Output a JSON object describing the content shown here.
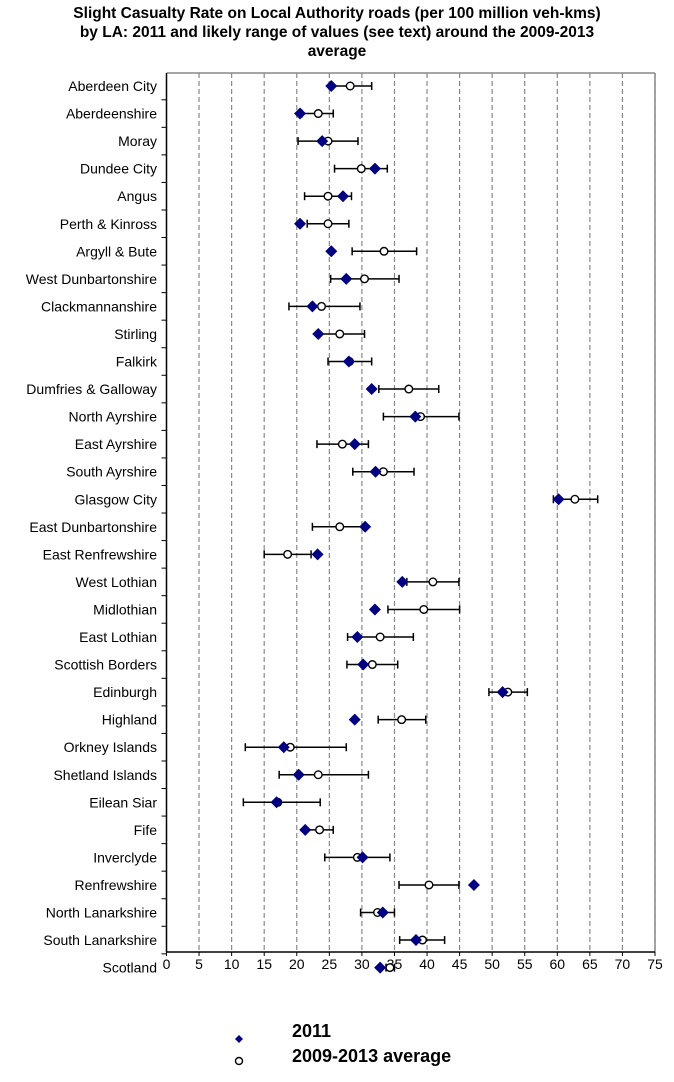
{
  "chart_data": {
    "type": "scatter",
    "orientation": "horizontal-dot-plot-with-error-bars",
    "title": "Slight Casualty Rate on Local Authority roads (per 100 million veh-kms) by LA: 2011 and likely range of values (see text) around the 2009-2013 average",
    "title_lines": [
      "Slight Casualty Rate on Local Authority roads (per 100 million veh-kms)",
      "by LA: 2011 and likely range of values (see text) around the 2009-2013",
      "average"
    ],
    "xlabel": "",
    "ylabel": "",
    "xlim": [
      0,
      75
    ],
    "x_ticks": [
      0,
      5,
      10,
      15,
      20,
      25,
      30,
      35,
      40,
      45,
      50,
      55,
      60,
      65,
      70,
      75
    ],
    "grid": "vertical dashed",
    "legend_position": "bottom",
    "legend": [
      {
        "name": "2011",
        "marker": "diamond",
        "color": "#000080"
      },
      {
        "name": "2009-2013 average",
        "marker": "open-circle",
        "color": "#000000"
      }
    ],
    "categories": [
      "Aberdeen City",
      "Aberdeenshire",
      "Moray",
      "Dundee City",
      "Angus",
      "Perth & Kinross",
      "Argyll & Bute",
      "West Dunbartonshire",
      "Clackmannanshire",
      "Stirling",
      "Falkirk",
      "Dumfries & Galloway",
      "North Ayrshire",
      "East Ayrshire",
      "South Ayrshire",
      "Glasgow City",
      "East Dunbartonshire",
      "East Renfrewshire",
      "West Lothian",
      "Midlothian",
      "East Lothian",
      "Scottish Borders",
      "Edinburgh",
      "Highland",
      "Orkney Islands",
      "Shetland Islands",
      "Eilean Siar",
      "Fife",
      "Inverclyde",
      "Renfrewshire",
      "North Lanarkshire",
      "South Lanarkshire",
      "Scotland"
    ],
    "series": [
      {
        "name": "2011",
        "values": [
          25.3,
          20.5,
          23.9,
          32.0,
          27.1,
          20.5,
          25.3,
          27.6,
          22.4,
          23.3,
          28.0,
          31.5,
          38.2,
          28.9,
          32.1,
          60.2,
          30.5,
          23.2,
          36.2,
          32.0,
          29.3,
          30.2,
          51.6,
          28.9,
          18.0,
          20.3,
          16.9,
          21.3,
          30.1,
          47.2,
          33.2,
          38.3,
          32.8
        ]
      },
      {
        "name": "2009-2013 average",
        "values": [
          28.2,
          23.3,
          24.8,
          29.9,
          24.8,
          24.8,
          33.4,
          30.4,
          23.8,
          26.6,
          28.1,
          37.2,
          39.0,
          27.0,
          33.3,
          62.7,
          26.6,
          18.6,
          40.9,
          39.5,
          32.8,
          31.6,
          52.4,
          36.1,
          19.0,
          23.3,
          17.1,
          23.5,
          29.3,
          40.3,
          32.4,
          39.3,
          34.3
        ],
        "range_low": [
          25.0,
          20.8,
          20.2,
          25.8,
          21.2,
          21.6,
          28.5,
          25.2,
          18.8,
          23.2,
          24.8,
          32.6,
          33.3,
          23.1,
          28.6,
          59.4,
          22.4,
          15.0,
          36.9,
          34.0,
          27.8,
          27.7,
          49.5,
          32.5,
          12.1,
          17.3,
          11.8,
          21.2,
          24.3,
          35.7,
          29.8,
          35.8,
          33.7
        ],
        "range_high": [
          31.5,
          25.6,
          29.4,
          33.9,
          28.4,
          28.0,
          38.4,
          35.7,
          29.7,
          30.4,
          31.5,
          41.8,
          44.9,
          31.0,
          38.0,
          66.2,
          30.5,
          22.2,
          44.9,
          45.0,
          37.9,
          35.5,
          55.4,
          39.8,
          27.6,
          31.0,
          23.6,
          25.6,
          34.3,
          44.9,
          35.0,
          42.7,
          35.0
        ]
      }
    ]
  }
}
